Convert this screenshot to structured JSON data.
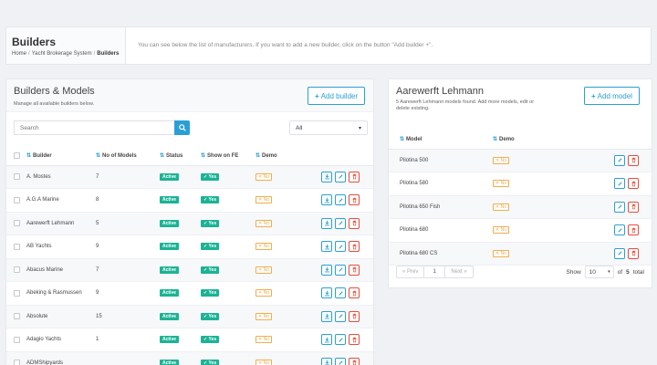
{
  "header": {
    "title": "Builders",
    "breadcrumb": [
      "Home",
      "Yacht Brokerage System",
      "Builders"
    ],
    "description": "You can see below the list of manufacturers. If you want to add a new builder, click on the button \"Add builder +\"."
  },
  "left": {
    "title": "Builders & Models",
    "subtitle": "Manage all available builders below.",
    "add_label": "Add builder",
    "search_placeholder": "Search",
    "filter_value": "All",
    "columns": [
      "Builder",
      "No of Models",
      "Status",
      "Show on FE",
      "Demo"
    ],
    "rows": [
      {
        "name": "A. Mostes",
        "models": "7",
        "status": "Active",
        "show": "Yes",
        "demo": "No"
      },
      {
        "name": "A.G.A Marine",
        "models": "8",
        "status": "Active",
        "show": "Yes",
        "demo": "No"
      },
      {
        "name": "Aarewerft Lehmann",
        "models": "5",
        "status": "Active",
        "show": "Yes",
        "demo": "No"
      },
      {
        "name": "AB Yachts",
        "models": "9",
        "status": "Active",
        "show": "Yes",
        "demo": "No"
      },
      {
        "name": "Abacus Marine",
        "models": "7",
        "status": "Active",
        "show": "Yes",
        "demo": "No"
      },
      {
        "name": "Abeking & Rasmussen",
        "models": "9",
        "status": "Active",
        "show": "Yes",
        "demo": "No"
      },
      {
        "name": "Absolute",
        "models": "15",
        "status": "Active",
        "show": "Yes",
        "demo": "No"
      },
      {
        "name": "Adagio Yachts",
        "models": "1",
        "status": "Active",
        "show": "Yes",
        "demo": "No"
      },
      {
        "name": "ADMShipyards",
        "models": "",
        "status": "Active",
        "show": "Yes",
        "demo": "No"
      }
    ]
  },
  "right": {
    "title": "Aarewerft Lehmann",
    "subtitle": "5 Aarewerft Lehmann models found. Add more models, edit or delete existing.",
    "add_label": "Add model",
    "columns": [
      "Model",
      "Demo"
    ],
    "rows": [
      {
        "name": "Pilotina 500",
        "demo": "No"
      },
      {
        "name": "Pilotina 580",
        "demo": "No"
      },
      {
        "name": "Pilotina 650 Fish",
        "demo": "No"
      },
      {
        "name": "Pilotina 680",
        "demo": "No"
      },
      {
        "name": "Pilotina 680 CS",
        "demo": "No"
      }
    ],
    "pager": {
      "prev": "« Prev",
      "page": "1",
      "next": "Next »"
    },
    "show": {
      "label": "Show",
      "value": "10",
      "of": "of",
      "total": "5",
      "suffix": "total"
    }
  }
}
